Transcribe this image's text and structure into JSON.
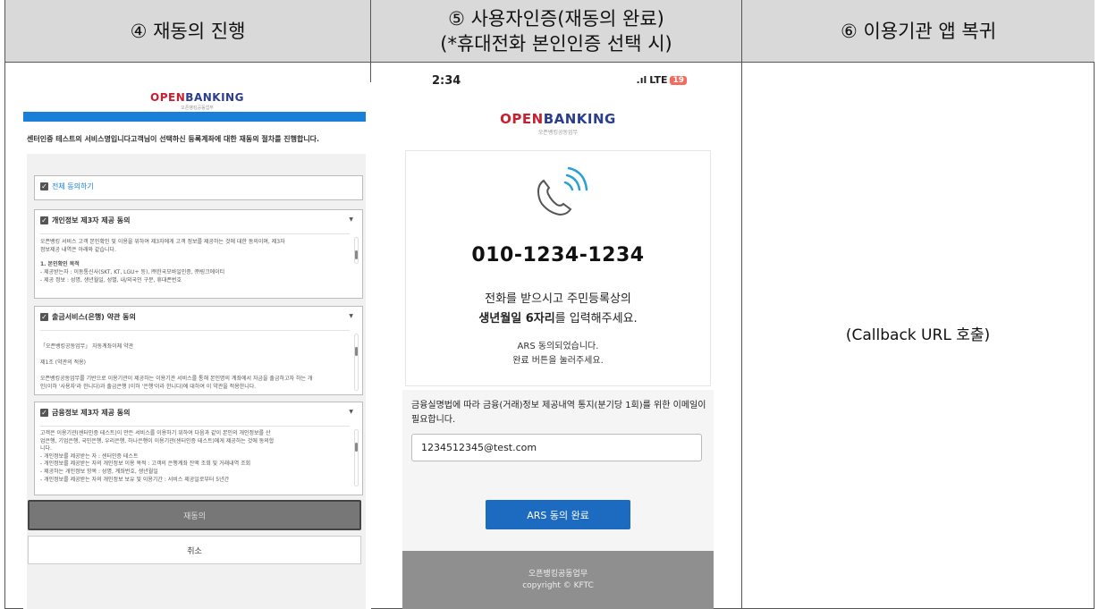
{
  "headers": [
    "④ 재동의 진행",
    "⑤ 사용자인증(재동의 완료)",
    "(*휴대전화 본인인증 선택 시)",
    "⑥ 이용기관 앱 복귀"
  ],
  "panel1": {
    "logo_open": "OPEN",
    "logo_banking": "BANKING",
    "logo_sub": "오픈뱅킹공동업무",
    "intro": "센터인증 테스트의 서비스명입니다고객님이 선택하신 등록계좌에 대한 재동의 절차를 진행합니다.",
    "all_agree": "전체 동의하기",
    "sections": [
      {
        "title": "개인정보 제3자 제공 동의",
        "lines": [
          "오픈뱅킹 서비스 고객 본인확인 및 이용을 위하여 제3자에게 고객 정보를 제공하는 것에 대한 동의이며, 제3자",
          "정보제공 내역은 아래와 같습니다.",
          "",
          "1. 본인확인 목적",
          "- 제공받는자 : 이동통신사(SKT, KT, LGU+ 등), ㈜한국모바일인증, ㈜링크에이티",
          "- 제공 정보 : 성명, 생년월일, 성별, 내/외국인 구분, 휴대폰번호"
        ]
      },
      {
        "title": "출금서비스(은행) 약관 동의",
        "lines": [
          "",
          "「오픈뱅킹공동업무」 자동계좌이체 약관",
          "",
          "제1조 (약관의 적용)",
          "",
          "오픈뱅킹공동업무를 기반으로 이용기관이 제공하는 이용기관 서비스를 통해 본인명의 계좌에서 자금을 출금하고자 하는 개",
          "인(이하 '사용자'라 한니다)과 출금은행 (이하 '은행'이라 한니다)에 대하여 이 약관을 적용한니다."
        ]
      },
      {
        "title": "금융정보 제3자 제공 동의",
        "lines": [
          "고객은 이용기관(센터인증 테스트)이 만든 서비스를 이용하기 위하여 다음과 같이 본인의 개인정보를 산",
          "업은행, 기업은행, 국민은행, 우리은행, 하나은행이 이용기관(센터인증 테스트)에게 제공하는 것에 동의합",
          "니다.",
          "- 개인정보를 제공받는 자 : 센터인증 테스트",
          "- 개인정보를 제공받는 자의 개인정보 이용 목적 : 고객의 은행계좌 잔액 조회 및 거래내역 조회",
          "- 제공하는 개인정보 항목 : 성명, 계좌번호, 생년월일",
          "- 개인정보를 제공받는 자의 개인정보 보유 및 이용기간 : 서비스 제공일로부터 5년간"
        ]
      }
    ],
    "btn_reagree": "재동의",
    "btn_cancel": "취소"
  },
  "panel2": {
    "time": "2:34",
    "network": "LTE",
    "battery": "19",
    "logo_open": "OPEN",
    "logo_banking": "BANKING",
    "logo_sub": "오픈뱅킹공동업무",
    "phone_number": "010-1234-1234",
    "msg1": "전화를 받으시고 주민등록상의",
    "msg2_bold": "생년월일 6자리",
    "msg2_rest": "를 입력해주세요.",
    "ars1": "ARS 동의되었습니다.",
    "ars2": "완료 버튼을 눌러주세요.",
    "law": "금융실명법에 따라 금융(거래)정보 제공내역 통지(분기당 1회)를 위한 이메일이 필요합니다.",
    "email": "1234512345@test.com",
    "btn_done": "ARS 동의 완료",
    "footer1": "오픈뱅킹공동업무",
    "footer2": "copyright © KFTC"
  },
  "panel3": {
    "text": "(Callback URL 호출)"
  }
}
